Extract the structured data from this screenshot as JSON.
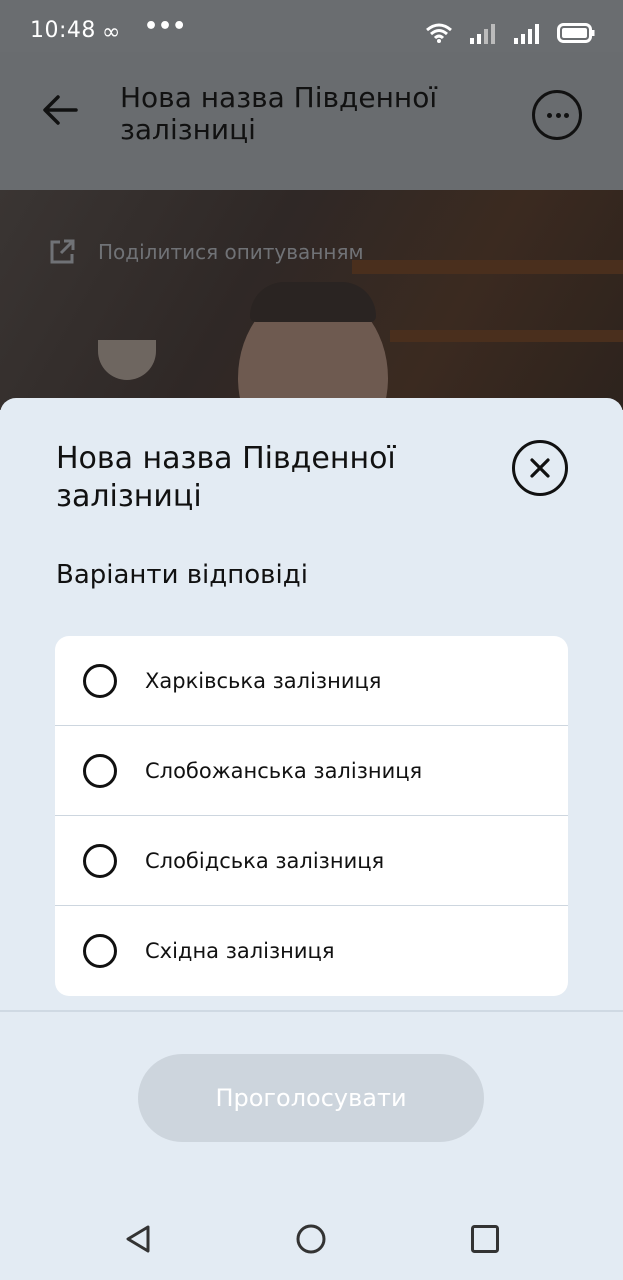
{
  "status_bar": {
    "time": "10:48",
    "loop_glyph": "∞",
    "dots_glyph": "•••",
    "icons": [
      "wifi-icon",
      "signal-icon",
      "signal-icon",
      "battery-icon"
    ]
  },
  "app_bar": {
    "title": "Нова назва Південної залізниці",
    "back_icon": "arrow-left-icon",
    "more_icon": "more-horizontal-icon"
  },
  "share": {
    "label": "Поділитися опитуванням",
    "icon": "external-link-icon"
  },
  "sheet": {
    "title": "Нова назва Південної залізниці",
    "subtitle": "Варіанти відповіді",
    "close_icon": "close-circle-icon",
    "options": [
      {
        "label": "Харківська залізниця",
        "selected": false
      },
      {
        "label": "Слобожанська залізниця",
        "selected": false
      },
      {
        "label": "Слобідська залізниця",
        "selected": false
      },
      {
        "label": "Східна залізниця",
        "selected": false
      }
    ],
    "vote_label": "Проголосувати"
  },
  "nav_bar": {
    "icons": [
      "nav-back-icon",
      "nav-home-icon",
      "nav-recents-icon"
    ]
  },
  "colors": {
    "sheet_bg": "#e3ebf3",
    "dim_overlay": "#696c6f",
    "button_disabled": "#cdd5dd"
  }
}
